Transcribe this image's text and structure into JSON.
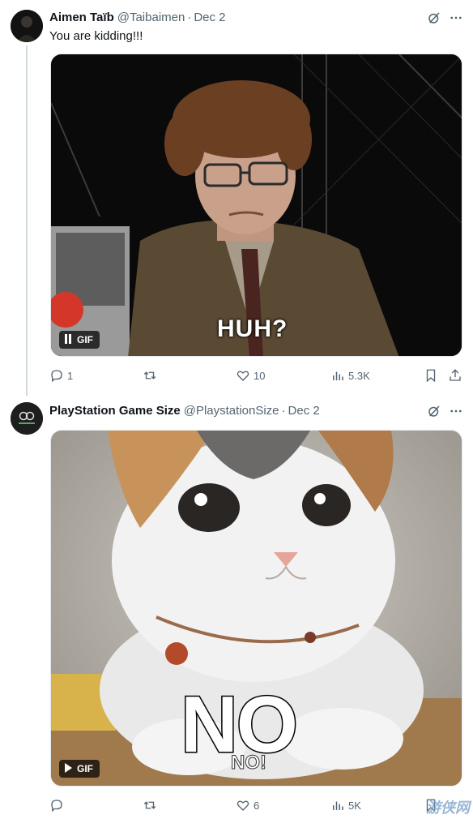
{
  "tweets": [
    {
      "author": {
        "name": "Aimen Taïb",
        "handle": "@Taibaimen"
      },
      "date": "Dec 2",
      "text": "You are kidding!!!",
      "media": {
        "type": "gif",
        "badge": "GIF",
        "caption": "HUH?",
        "control": "pause"
      },
      "stats": {
        "replies": "1",
        "retweets": "",
        "likes": "10",
        "views": "5.3K"
      }
    },
    {
      "author": {
        "name": "PlayStation Game Size",
        "handle": "@PlaystationSize"
      },
      "date": "Dec 2",
      "text": "",
      "media": {
        "type": "gif",
        "badge": "GIF",
        "caption": "NO",
        "subcaption": "NO!",
        "control": "play"
      },
      "stats": {
        "replies": "",
        "retweets": "",
        "likes": "6",
        "views": "5K"
      }
    }
  ],
  "separator": "·",
  "watermark": "游侠网",
  "colors": {
    "text": "#0f1419",
    "secondary": "#536471",
    "thread_line": "#cfd9de"
  },
  "icons": [
    "grok-icon",
    "more-icon",
    "reply-icon",
    "retweet-icon",
    "like-icon",
    "views-icon",
    "bookmark-icon",
    "share-icon",
    "pause-icon",
    "play-icon"
  ]
}
